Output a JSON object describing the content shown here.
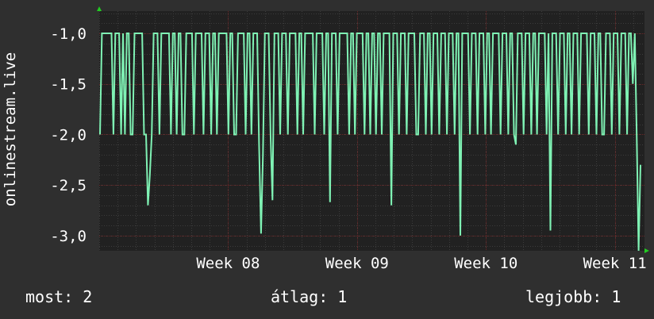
{
  "colors": {
    "background": "#2f2f2f",
    "plot_bg": "#212121",
    "grid_minor": "#3c3c3c",
    "grid_major": "#6a2626",
    "line": "#7ff2b4",
    "axis_arrow": "#22cc22",
    "text": "#ffffff"
  },
  "legend": {
    "current": "most: 2",
    "average": "átlag: 1",
    "best": "legjobb: 1"
  },
  "chart_data": {
    "type": "line",
    "title": "",
    "ylabel": "onlinestream.live",
    "xlabel": "",
    "ylim": [
      -3.15,
      -0.78
    ],
    "y_ticks": [
      -1.0,
      -1.5,
      -2.0,
      -2.5,
      -3.0
    ],
    "y_tick_labels": [
      "-1,0",
      "-1,5",
      "-2,0",
      "-2,5",
      "-3,0"
    ],
    "x_ticks": [
      {
        "label": "Week 08",
        "pos": 1.0
      },
      {
        "label": "Week 09",
        "pos": 2.0
      },
      {
        "label": "Week 10",
        "pos": 3.0
      },
      {
        "label": "Week 11",
        "pos": 4.0
      }
    ],
    "xlim": [
      0.0,
      4.23
    ],
    "series": [
      {
        "values": [
          -2,
          -1,
          -1,
          -1,
          -1,
          -1,
          -1,
          -2,
          -1,
          -1,
          -1,
          -2,
          -1,
          -2,
          -1,
          -1,
          -2,
          -2,
          -1,
          -1,
          -1,
          -1,
          -1,
          -2,
          -2,
          -2.7,
          -2.4,
          -2,
          -1,
          -1,
          -1,
          -2,
          -1,
          -1,
          -1,
          -1,
          -1,
          -2,
          -1,
          -1,
          -2,
          -1,
          -1,
          -2,
          -2,
          -1,
          -1,
          -1,
          -1,
          -2,
          -1,
          -1,
          -1,
          -1,
          -2,
          -1,
          -1,
          -1,
          -2,
          -1,
          -1,
          -2,
          -1,
          -1,
          -1,
          -1,
          -1,
          -2,
          -1,
          -1,
          -2,
          -2,
          -1,
          -1,
          -1,
          -1,
          -2,
          -1,
          -1,
          -2,
          -1,
          -1,
          -1,
          -2.1,
          -2.98,
          -2.2,
          -1,
          -1,
          -1,
          -2,
          -2.65,
          -1,
          -1,
          -1,
          -2,
          -1,
          -1,
          -1,
          -2,
          -1,
          -1,
          -1,
          -1,
          -2,
          -1,
          -1,
          -2,
          -1,
          -1,
          -1,
          -1,
          -1,
          -2,
          -1,
          -1,
          -1,
          -1,
          -2,
          -1,
          -1,
          -2.67,
          -1,
          -1,
          -1,
          -2,
          -1,
          -1,
          -1,
          -1,
          -1,
          -2,
          -1,
          -1,
          -2,
          -1,
          -1,
          -1,
          -1,
          -2,
          -1,
          -1,
          -2,
          -1,
          -1,
          -2,
          -1,
          -1,
          -2,
          -1,
          -1,
          -1,
          -1,
          -2.7,
          -1,
          -1,
          -1,
          -2,
          -1,
          -1,
          -1,
          -2,
          -1,
          -1,
          -1,
          -1,
          -2,
          -2,
          -1,
          -1,
          -1,
          -2,
          -1,
          -1,
          -2,
          -1,
          -1,
          -1,
          -2,
          -1,
          -1,
          -1,
          -2,
          -1,
          -1,
          -1,
          -2,
          -1,
          -1,
          -3.0,
          -1,
          -1,
          -1,
          -1,
          -2,
          -1,
          -1,
          -1,
          -2,
          -1,
          -1,
          -1,
          -2,
          -1,
          -1,
          -2,
          -1,
          -1,
          -1,
          -1,
          -2,
          -1,
          -1,
          -1,
          -2,
          -1,
          -1,
          -2,
          -2.1,
          -1,
          -1,
          -1,
          -2,
          -1,
          -1,
          -1,
          -2,
          -1,
          -1,
          -2,
          -1,
          -1,
          -1,
          -1,
          -2,
          -1,
          -2.95,
          -1,
          -1,
          -1,
          -2,
          -1,
          -1,
          -1,
          -2,
          -1,
          -1,
          -2,
          -1,
          -1,
          -1,
          -2,
          -1,
          -1,
          -1,
          -1,
          -2,
          -1,
          -1,
          -1,
          -2,
          -1,
          -1,
          -2,
          -2,
          -1,
          -1,
          -1,
          -2,
          -1,
          -1,
          -1,
          -2,
          -1,
          -1,
          -1,
          -2,
          -1,
          -1,
          -1.5,
          -1,
          -2,
          -3.15,
          -2.3
        ]
      }
    ]
  }
}
